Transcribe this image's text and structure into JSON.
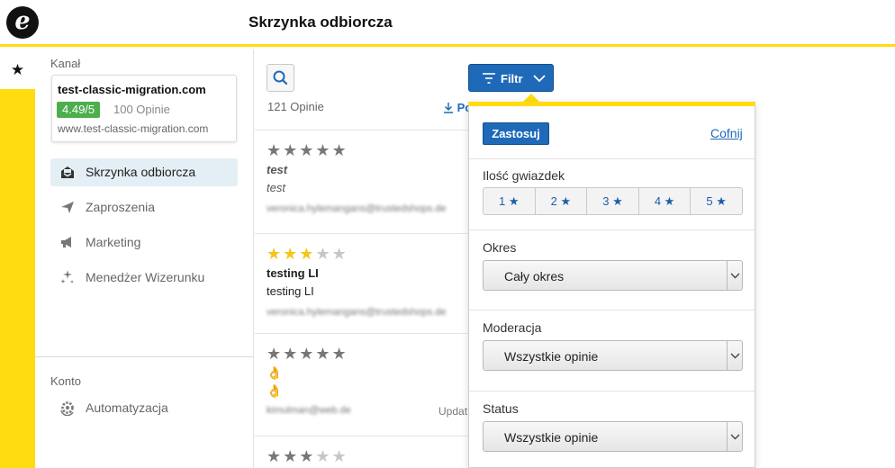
{
  "header": {
    "logo_icon": "trusted-shops-e-logo",
    "title": "Skrzynka odbiorcza"
  },
  "rail": {
    "star_glyph": "★"
  },
  "sidebar": {
    "channel_label": "Kanał",
    "channel": {
      "name": "test-classic-migration.com",
      "rating": "4.49/5",
      "reviews": "100 Opinie",
      "url": "www.test-classic-migration.com"
    },
    "nav": [
      {
        "label": "Skrzynka odbiorcza",
        "icon": "inbox-icon",
        "active": true
      },
      {
        "label": "Zaproszenia",
        "icon": "paper-plane-icon",
        "active": false
      },
      {
        "label": "Marketing",
        "icon": "megaphone-icon",
        "active": false
      },
      {
        "label": "Menedżer Wizerunku",
        "icon": "sparkles-icon",
        "active": false
      }
    ],
    "account_label": "Konto",
    "account_nav": [
      {
        "label": "Automatyzacja",
        "icon": "gear-refresh-icon"
      }
    ]
  },
  "list": {
    "count": "121 Opinie",
    "download_label": "Po",
    "filter_label": "Filtr",
    "reviews": [
      {
        "stars": 5,
        "title": "test",
        "text": "test",
        "email": "veronica.hylemangans@trustedshops.de",
        "update": ""
      },
      {
        "stars": 3,
        "title": "testing LI",
        "text": "testing LI",
        "email": "veronica.hylemangans@trustedshops.de",
        "update": ""
      },
      {
        "stars": 5,
        "title": "👌",
        "text": "👌",
        "email": "kimulman@web.de",
        "update": "Updat"
      },
      {
        "stars": 3,
        "title": "",
        "text": "",
        "email": "",
        "update": ""
      }
    ]
  },
  "filter_panel": {
    "apply_label": "Zastosuj",
    "reset_label": "Cofnij",
    "stars_label": "Ilość gwiazdek",
    "star_options": [
      "1 ★",
      "2 ★",
      "3 ★",
      "4 ★",
      "5 ★"
    ],
    "period_label": "Okres",
    "period_value": "Cały okres",
    "moderation_label": "Moderacja",
    "moderation_value": "Wszystkie opinie",
    "status_label": "Status",
    "status_value": "Wszystkie opinie"
  },
  "colors": {
    "accent_yellow": "#ffdc0f",
    "primary_blue": "#1f6ab8",
    "rating_green": "#4cae4c",
    "star_gold": "#f5c518"
  }
}
